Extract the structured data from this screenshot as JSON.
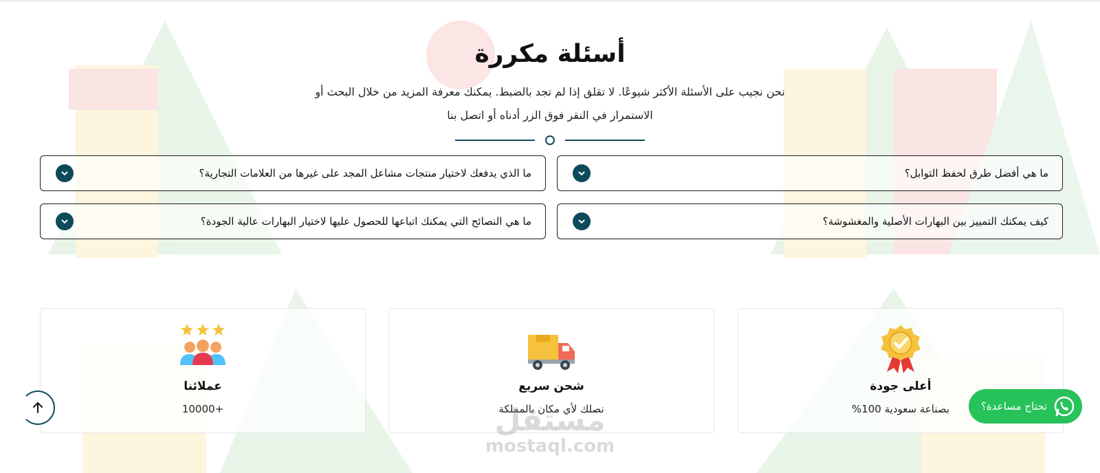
{
  "faq": {
    "title": "أسئلة مكررة",
    "subtitle": "نحن نجيب على الأسئلة الأكثر شيوعًا. لا تقلق إذا لم تجد بالضبط. يمكنك معرفة المزيد من خلال البحث أو الاستمرار في النقر فوق الزر أدناه أو اتصل بنا",
    "questions": [
      "ما هي أفضل طرق لحفظ التوابل؟",
      "ما الذي يدفعك لاختيار منتجات مشاعل المجد على غيرها من العلامات التجارية؟",
      "كيف يمكنك التمييز بين البهارات الأصلية والمغشوشة؟",
      "ما هي النصائح التي يمكنك اتباعها للحصول عليها لاختيار البهارات عالية الجودة؟"
    ]
  },
  "features": [
    {
      "icon": "quality-medal-icon",
      "title": "أعلى جودة",
      "desc": "بصناعة سعودية 100%"
    },
    {
      "icon": "delivery-truck-icon",
      "title": "شحن سريع",
      "desc": "نصلك لأي مكان بالمملكة"
    },
    {
      "icon": "customers-stars-icon",
      "title": "عملائنا",
      "desc": "+10000"
    }
  ],
  "whatsapp": {
    "label": "تحتاج مساعدة؟",
    "color": "#27c25a"
  },
  "watermark": {
    "ar": "مستقل",
    "en": "mostaql.com"
  },
  "colors": {
    "accent": "#0e4a5b"
  }
}
